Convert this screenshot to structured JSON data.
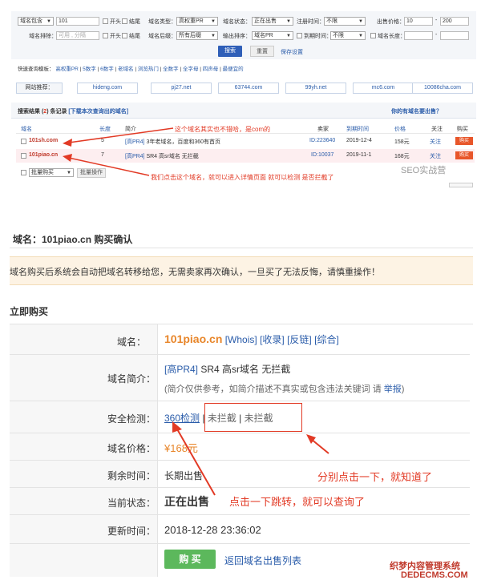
{
  "search": {
    "row1": {
      "domain_sel": "域名包含",
      "domain_val": "101",
      "begin_label": "开头",
      "end_label": "结尾",
      "type_label": "域名类型：",
      "type_sel": "高权重PR",
      "status_label": "域名状态：",
      "status_sel": "正在出售",
      "reg_label": "注册时间：",
      "reg_sel": "不限",
      "price_label": "出售价格：",
      "price_min": "10",
      "price_dash": "-",
      "price_max": "200"
    },
    "row2": {
      "exclude_label": "域名排除：",
      "exclude_placeholder": "可用 , 分隔",
      "begin_label": "开头",
      "end_label": "结尾",
      "suffix_label": "域名后缀：",
      "suffix_sel": "所有后缀",
      "output_label": "输出排序：",
      "output_sel": "域名PR",
      "expire_label": "到期时间：",
      "expire_sel": "不限",
      "len_label": "域名长度：",
      "len_dash": "-"
    },
    "search_btn": "搜索",
    "reset_btn": "重置",
    "save_link": "保存设置"
  },
  "quick_search": {
    "label": "快速查询模板：",
    "items": [
      "高权重PR",
      "5数字",
      "6数字",
      "老域名",
      "浏览热门",
      "全数字",
      "全字母",
      "四声母",
      "最便宜的"
    ]
  },
  "sites": {
    "label": "网站推荐：",
    "items": [
      "hideng.com",
      "pj27.net",
      "63744.com",
      "99yh.net",
      "mc6.com",
      "10086cha.com"
    ]
  },
  "results": {
    "prefix": "搜索结果 (",
    "count": "2",
    "suffix": ") 条记录",
    "download_link": "[下载本次查询出的域名]",
    "right_link": "你的有域名要出售？",
    "headers": {
      "domain": "域名",
      "len": "长度",
      "desc": "简介",
      "seller": "卖家",
      "expire": "到期时间",
      "price": "价格",
      "follow": "关注",
      "buy": "购买"
    },
    "rows": [
      {
        "domain": "101sh.com",
        "len": "5",
        "desc_tag": "[高PR4]",
        "desc": " 3年老域名，百度和360有首页",
        "seller": "ID:223640",
        "expire": "2019-12-4",
        "price": "158元",
        "follow": "关注",
        "buy": "购买"
      },
      {
        "domain": "101piao.cn",
        "len": "7",
        "desc_tag": "[高PR4]",
        "desc": " SR4 高sr域名 无拦截",
        "seller": "ID:10037",
        "expire": "2019-11-1",
        "price": "168元",
        "follow": "关注",
        "buy": "购买"
      }
    ],
    "batch_sel": "批量购买",
    "batch_btn": "批量操作",
    "annotation1": "这个域名其实也不错哈，是com的",
    "annotation2": "我们点击这个域名，就可以进入详情页面 就可以检测 是否拦截了",
    "watermark1": "SEO实战营"
  },
  "confirm": {
    "title": "域名：101piao.cn 购买确认",
    "notice": "域名购买后系统会自动把域名转移给您，无需卖家再次确认，一旦买了无法反悔，请慎重操作！",
    "section": "立即购买",
    "fields": {
      "domain_label": "域名：",
      "domain_val": "101piao.cn",
      "whois": "[Whois]",
      "collect": "[收录]",
      "backlink": "[反链]",
      "combined": "[综合]",
      "desc_label": "域名简介：",
      "desc_tag": "[高PR4]",
      "desc_val": " SR4 高sr域名 无拦截",
      "desc_note": "(简介仅供参考，如简介描述不真实或包含违法关键词 请 ",
      "report": "举报",
      "desc_note_end": ")",
      "security_label": "安全检测：",
      "sec360": "360检测",
      "sec_sep1": " | ",
      "sec_a": "未拦截",
      "sec_sep2": " | ",
      "sec_b": "未拦截",
      "price_label": "域名价格：",
      "price_val": "¥168元",
      "remain_label": "剩余时间：",
      "remain_val": "长期出售",
      "status_label": "当前状态：",
      "status_val": "正在出售",
      "update_label": "更新时间：",
      "update_val": "2018-12-28 23:36:02"
    },
    "buy_btn": "购 买",
    "back_link": "返回域名出售列表",
    "annotation3": "分别点击一下，就知道了",
    "annotation4": "点击一下跳转，就可以查询了",
    "watermark2": "织梦内容管理系统",
    "watermark3": "DEDECMS.COM"
  },
  "colors": {
    "accent": "#2f5fb8",
    "link": "#2a5caa",
    "annotation": "#e23a25",
    "buy": "#5cb85c"
  }
}
